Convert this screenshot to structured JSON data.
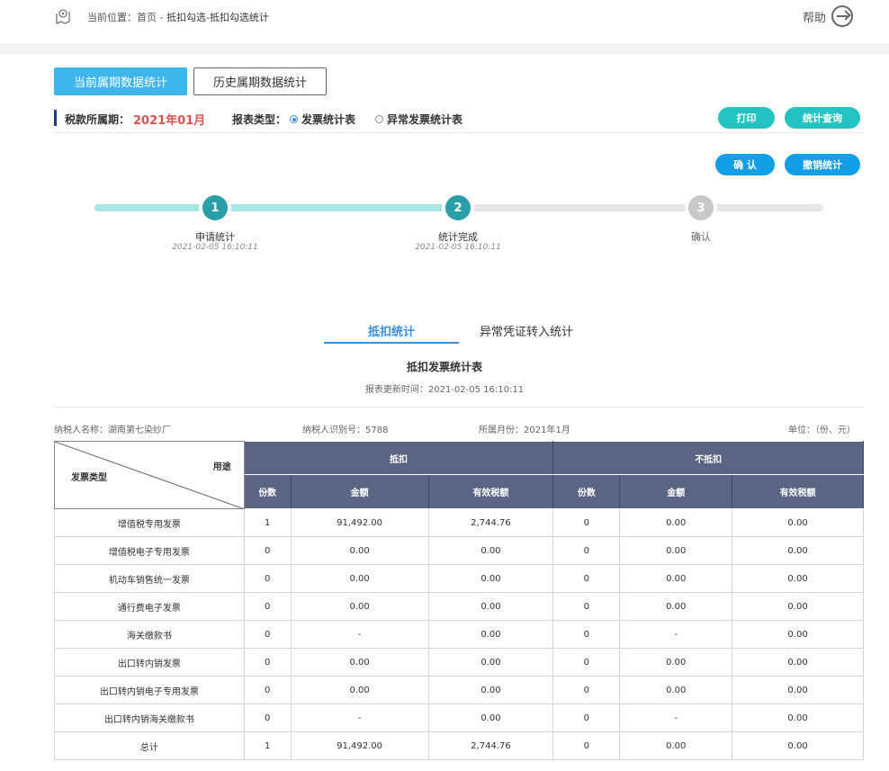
{
  "breadcrumb": {
    "prefix": "当前位置：",
    "home": "首页",
    "sep": " - ",
    "current": "抵扣勾选-抵扣勾选统计"
  },
  "help": {
    "label": "帮助"
  },
  "tabs": {
    "current": "当前属期数据统计",
    "history": "历史属期数据统计"
  },
  "filter": {
    "period_label": "税款所属期：",
    "period_value": "2021年01月",
    "type_label": "报表类型：",
    "options": [
      {
        "label": "发票统计表",
        "checked": true
      },
      {
        "label": "异常发票统计表",
        "checked": false
      }
    ]
  },
  "buttons": {
    "print": "打印",
    "query": "统计查询",
    "confirm": "确 认",
    "revoke": "撤销统计"
  },
  "steps": [
    {
      "num": "1",
      "label": "申请统计",
      "time": "2021-02-05 16:10:11",
      "done": true
    },
    {
      "num": "2",
      "label": "统计完成",
      "time": "2021-02-05 16:10:11",
      "done": true
    },
    {
      "num": "3",
      "label": "确认",
      "time": "",
      "done": false
    }
  ],
  "subtabs": {
    "active": "抵扣统计",
    "inactive": "异常凭证转入统计"
  },
  "report": {
    "title": "抵扣发票统计表",
    "time_label": "报表更新时间：",
    "time": "2021-02-05 16:10:11"
  },
  "info": {
    "taxpayer_name": "纳税人名称：湖南第七染纱厂",
    "taxpayer_id": "纳税人识别号：5788",
    "month": "所属月份：2021年1月",
    "unit": "单位：（份、元）"
  },
  "table": {
    "diag_top": "用途",
    "diag_bottom": "发票类型",
    "group_deduct": "抵扣",
    "group_nondeduct": "不抵扣",
    "sub": {
      "count": "份数",
      "amount": "金额",
      "tax": "有效税额"
    },
    "rows": [
      {
        "type": "增值税专用发票",
        "c1": "1",
        "a1": "91,492.00",
        "t1": "2,744.76",
        "c2": "0",
        "a2": "0.00",
        "t2": "0.00"
      },
      {
        "type": "增值税电子专用发票",
        "c1": "0",
        "a1": "0.00",
        "t1": "0.00",
        "c2": "0",
        "a2": "0.00",
        "t2": "0.00"
      },
      {
        "type": "机动车销售统一发票",
        "c1": "0",
        "a1": "0.00",
        "t1": "0.00",
        "c2": "0",
        "a2": "0.00",
        "t2": "0.00"
      },
      {
        "type": "通行费电子发票",
        "c1": "0",
        "a1": "0.00",
        "t1": "0.00",
        "c2": "0",
        "a2": "0.00",
        "t2": "0.00"
      },
      {
        "type": "海关缴款书",
        "c1": "0",
        "a1": "-",
        "t1": "0.00",
        "c2": "0",
        "a2": "-",
        "t2": "0.00"
      },
      {
        "type": "出口转内销发票",
        "c1": "0",
        "a1": "0.00",
        "t1": "0.00",
        "c2": "0",
        "a2": "0.00",
        "t2": "0.00"
      },
      {
        "type": "出口转内销电子专用发票",
        "c1": "0",
        "a1": "0.00",
        "t1": "0.00",
        "c2": "0",
        "a2": "0.00",
        "t2": "0.00"
      },
      {
        "type": "出口转内销海关缴款书",
        "c1": "0",
        "a1": "-",
        "t1": "0.00",
        "c2": "0",
        "a2": "-",
        "t2": "0.00"
      },
      {
        "type": "总计",
        "c1": "1",
        "a1": "91,492.00",
        "t1": "2,744.76",
        "c2": "0",
        "a2": "0.00",
        "t2": "0.00"
      }
    ]
  },
  "colors": {
    "primary": "#3eb6ec",
    "teal": "#23c3c3",
    "blue": "#139ee8",
    "header": "#596582",
    "period": "#d9534f",
    "step_done": "#2a9fa8"
  }
}
